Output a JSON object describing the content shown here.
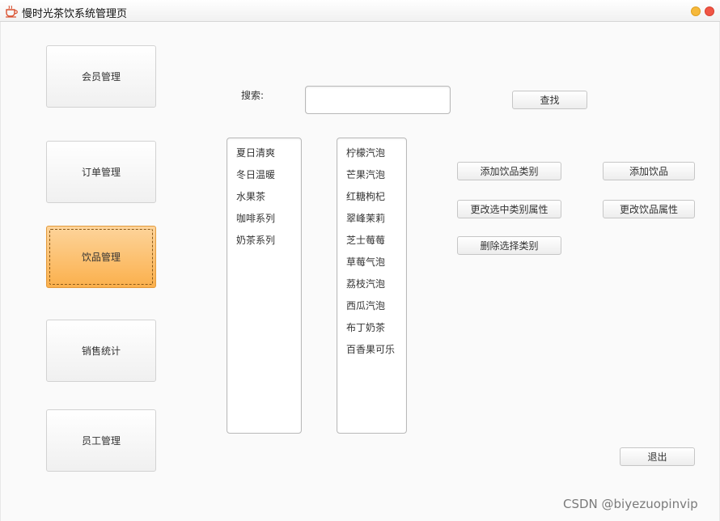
{
  "window": {
    "title": "慢时光茶饮系统管理页"
  },
  "nav": [
    {
      "label": "会员管理",
      "active": false
    },
    {
      "label": "订单管理",
      "active": false
    },
    {
      "label": "饮品管理",
      "active": true
    },
    {
      "label": "销售统计",
      "active": false
    },
    {
      "label": "员工管理",
      "active": false
    }
  ],
  "search": {
    "label": "搜索:",
    "value": "",
    "button": "查找"
  },
  "categories": [
    "夏日清爽",
    "冬日温暖",
    "水果茶",
    "咖啡系列",
    "奶茶系列"
  ],
  "drinks": [
    "柠檬汽泡",
    "芒果汽泡",
    "红糖枸杞",
    "翠峰茉莉",
    "芝士莓莓",
    "草莓气泡",
    "荔枝汽泡",
    "西瓜汽泡",
    "布丁奶茶",
    "百香果可乐"
  ],
  "actions": {
    "add_category": "添加饮品类别",
    "edit_category": "更改选中类别属性",
    "delete_category": "删除选择类别",
    "add_drink": "添加饮品",
    "edit_drink": "更改饮品属性",
    "exit": "退出"
  },
  "watermark": "CSDN @biyezuopinvip",
  "colors": {
    "active_nav": "#fbb04c",
    "close": "#f05545",
    "minimize": "#f6b93b"
  }
}
